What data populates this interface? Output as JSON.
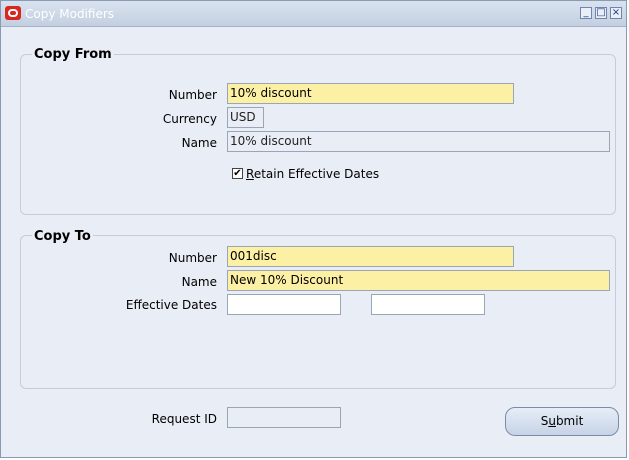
{
  "window": {
    "title": "Copy Modifiers"
  },
  "copy_from": {
    "title": "Copy From",
    "number_label": "Number",
    "number_value": "10% discount",
    "currency_label": "Currency",
    "currency_value": "USD",
    "name_label": "Name",
    "name_value": "10% discount",
    "retain_label_prefix": "R",
    "retain_label_rest": "etain Effective Dates",
    "retain_checked": true
  },
  "copy_to": {
    "title": "Copy To",
    "number_label": "Number",
    "number_value": "001disc",
    "name_label": "Name",
    "name_value": "New 10% Discount",
    "dates_label": "Effective Dates",
    "date_from": "",
    "date_to": ""
  },
  "footer": {
    "request_label": "Request ID",
    "request_value": "",
    "submit_prefix": "S",
    "submit_mnemonic": "u",
    "submit_rest": "bmit"
  }
}
